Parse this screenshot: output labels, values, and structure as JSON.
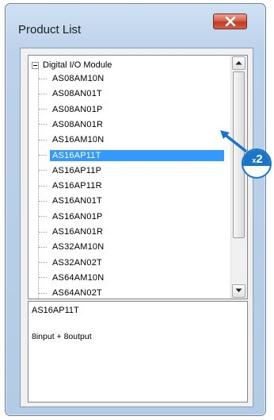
{
  "window": {
    "title": "Product List"
  },
  "tree": {
    "root_label": "Digital I/O Module",
    "items": [
      "AS08AM10N",
      "AS08AN01T",
      "AS08AN01P",
      "AS08AN01R",
      "AS16AM10N",
      "AS16AP11T",
      "AS16AP11P",
      "AS16AP11R",
      "AS16AN01T",
      "AS16AN01P",
      "AS16AN01R",
      "AS32AM10N",
      "AS32AN02T",
      "AS64AM10N",
      "AS64AN02T"
    ],
    "selected_index": 5
  },
  "description": {
    "name": "AS16AP11T",
    "text": "8input + 8output"
  },
  "callout": {
    "prefix": "x",
    "number": "2"
  },
  "icons": {
    "close": "close-x-icon",
    "expander": "minus-expander-icon",
    "scroll_up": "arrow-up-icon",
    "scroll_down": "arrow-down-icon",
    "callout_arrow": "pointer-arrow-icon"
  },
  "colors": {
    "selection": "#3399ff",
    "close_button": "#c03a24",
    "callout": "#1a74c8"
  }
}
